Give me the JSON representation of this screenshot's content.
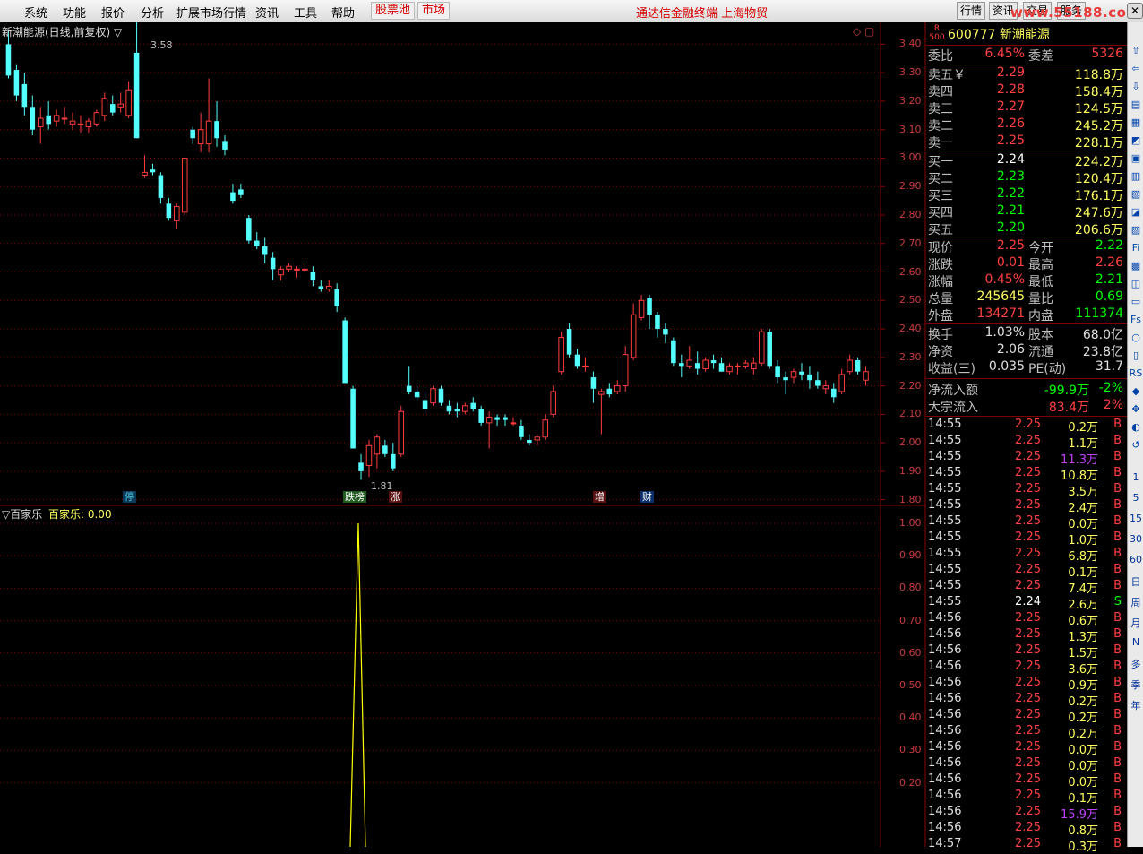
{
  "menu": {
    "items": [
      "系统",
      "功能",
      "报价",
      "分析",
      "扩展市场行情",
      "资讯",
      "工具",
      "帮助"
    ],
    "boxed": [
      "股票池",
      "市场"
    ],
    "center_title": "通达信金融终端  上海物贸",
    "right_buttons": [
      "行情",
      "资讯",
      "交易",
      "服务"
    ],
    "watermark": "www.55188.com"
  },
  "chart": {
    "title": "新潮能源(日线,前复权) ▽",
    "max_label": "3.58",
    "min_label": "1.81",
    "y_ticks": [
      "3.40",
      "3.30",
      "3.20",
      "3.10",
      "3.00",
      "2.90",
      "2.80",
      "2.70",
      "2.60",
      "2.50",
      "2.40",
      "2.30",
      "2.20",
      "2.10",
      "2.00",
      "1.90",
      "1.80"
    ],
    "markers": [
      {
        "text": "停",
        "color": "#4cc3d9",
        "bg": "#0b3a58"
      },
      {
        "text": "跌榜",
        "color": "#ffffff",
        "bg": "#1f5a1f"
      },
      {
        "text": "涨",
        "color": "#ffffff",
        "bg": "#5a1010"
      },
      {
        "text": "增",
        "color": "#ffffff",
        "bg": "#5a1010"
      },
      {
        "text": "财",
        "color": "#ffffff",
        "bg": "#0b2f6a"
      }
    ],
    "colors": {
      "up": "#ff3c3c",
      "down": "#54ffff",
      "grid": "#8b0000",
      "text": "#c83c3c"
    }
  },
  "indicator": {
    "name": "▽百家乐",
    "value_label": "百家乐: 0.00",
    "y_ticks": [
      "1.00",
      "0.90",
      "0.80",
      "0.70",
      "0.60",
      "0.50",
      "0.40",
      "0.30",
      "0.20"
    ],
    "line_color": "#ffff00"
  },
  "quote": {
    "code": "600777",
    "name": "新潮能源",
    "badge_top": "R",
    "badge_bottom": "500",
    "weibi_label": "委比",
    "weibi": "6.45%",
    "weicha_label": "委差",
    "weicha": "5326",
    "asks": [
      {
        "label": "卖五￥",
        "price": "2.29",
        "vol": "118.8万"
      },
      {
        "label": "卖四",
        "price": "2.28",
        "vol": "158.4万"
      },
      {
        "label": "卖三",
        "price": "2.27",
        "vol": "124.5万"
      },
      {
        "label": "卖二",
        "price": "2.26",
        "vol": "245.2万"
      },
      {
        "label": "卖一",
        "price": "2.25",
        "vol": "228.1万"
      }
    ],
    "bids": [
      {
        "label": "买一",
        "price": "2.24",
        "vol": "224.2万",
        "color": "#ffffff"
      },
      {
        "label": "买二",
        "price": "2.23",
        "vol": "120.4万",
        "color": "#00ff00"
      },
      {
        "label": "买三",
        "price": "2.22",
        "vol": "176.1万",
        "color": "#00ff00"
      },
      {
        "label": "买四",
        "price": "2.21",
        "vol": "247.6万",
        "color": "#00ff00"
      },
      {
        "label": "买五",
        "price": "2.20",
        "vol": "206.6万",
        "color": "#00ff00"
      }
    ],
    "stats": [
      {
        "l1": "现价",
        "v1": "2.25",
        "c1": "#ff4040",
        "l2": "今开",
        "v2": "2.22",
        "c2": "#00ff00"
      },
      {
        "l1": "涨跌",
        "v1": "0.01",
        "c1": "#ff4040",
        "l2": "最高",
        "v2": "2.26",
        "c2": "#ff4040"
      },
      {
        "l1": "涨幅",
        "v1": "0.45%",
        "c1": "#ff4040",
        "l2": "最低",
        "v2": "2.21",
        "c2": "#00ff00"
      },
      {
        "l1": "总量",
        "v1": "245645",
        "c1": "#ffff60",
        "l2": "量比",
        "v2": "0.69",
        "c2": "#00ff00"
      },
      {
        "l1": "外盘",
        "v1": "134271",
        "c1": "#ff4040",
        "l2": "内盘",
        "v2": "111374",
        "c2": "#00ff00"
      }
    ],
    "stats2": [
      {
        "l1": "换手",
        "v1": "1.03%",
        "l2": "股本",
        "v2": "68.0亿"
      },
      {
        "l1": "净资",
        "v1": "2.06",
        "l2": "流通",
        "v2": "23.8亿"
      },
      {
        "l1": "收益(三)",
        "v1": "0.035",
        "l2": "PE(动)",
        "v2": "31.7"
      }
    ],
    "flow": [
      {
        "label": "净流入额",
        "v1": "-99.9万",
        "c1": "#00ff00",
        "v2": "-2%",
        "c2": "#00ff00"
      },
      {
        "label": "大宗流入",
        "v1": "83.4万",
        "c1": "#ff4040",
        "v2": "2%",
        "c2": "#ff4040"
      }
    ]
  },
  "ticks": [
    {
      "t": "14:55",
      "p": "2.25",
      "v": "0.2万",
      "s": "B",
      "pc": "#ff4040",
      "vc": "#ffff60",
      "sc": "#ff4040"
    },
    {
      "t": "14:55",
      "p": "2.25",
      "v": "1.1万",
      "s": "B",
      "pc": "#ff4040",
      "vc": "#ffff60",
      "sc": "#ff4040"
    },
    {
      "t": "14:55",
      "p": "2.25",
      "v": "11.3万",
      "s": "B",
      "pc": "#ff4040",
      "vc": "#c040ff",
      "sc": "#ff4040"
    },
    {
      "t": "14:55",
      "p": "2.25",
      "v": "10.8万",
      "s": "B",
      "pc": "#ff4040",
      "vc": "#ffff60",
      "sc": "#ff4040"
    },
    {
      "t": "14:55",
      "p": "2.25",
      "v": "3.5万",
      "s": "B",
      "pc": "#ff4040",
      "vc": "#ffff60",
      "sc": "#ff4040"
    },
    {
      "t": "14:55",
      "p": "2.25",
      "v": "2.4万",
      "s": "B",
      "pc": "#ff4040",
      "vc": "#ffff60",
      "sc": "#ff4040"
    },
    {
      "t": "14:55",
      "p": "2.25",
      "v": "0.0万",
      "s": "B",
      "pc": "#ff4040",
      "vc": "#ffff60",
      "sc": "#ff4040"
    },
    {
      "t": "14:55",
      "p": "2.25",
      "v": "1.0万",
      "s": "B",
      "pc": "#ff4040",
      "vc": "#ffff60",
      "sc": "#ff4040"
    },
    {
      "t": "14:55",
      "p": "2.25",
      "v": "6.8万",
      "s": "B",
      "pc": "#ff4040",
      "vc": "#ffff60",
      "sc": "#ff4040"
    },
    {
      "t": "14:55",
      "p": "2.25",
      "v": "0.1万",
      "s": "B",
      "pc": "#ff4040",
      "vc": "#ffff60",
      "sc": "#ff4040"
    },
    {
      "t": "14:55",
      "p": "2.25",
      "v": "7.4万",
      "s": "B",
      "pc": "#ff4040",
      "vc": "#ffff60",
      "sc": "#ff4040"
    },
    {
      "t": "14:55",
      "p": "2.24",
      "v": "2.6万",
      "s": "S",
      "pc": "#ffffff",
      "vc": "#ffff60",
      "sc": "#00ff00"
    },
    {
      "t": "14:56",
      "p": "2.25",
      "v": "0.6万",
      "s": "B",
      "pc": "#ff4040",
      "vc": "#ffff60",
      "sc": "#ff4040"
    },
    {
      "t": "14:56",
      "p": "2.25",
      "v": "1.3万",
      "s": "B",
      "pc": "#ff4040",
      "vc": "#ffff60",
      "sc": "#ff4040"
    },
    {
      "t": "14:56",
      "p": "2.25",
      "v": "1.5万",
      "s": "B",
      "pc": "#ff4040",
      "vc": "#ffff60",
      "sc": "#ff4040"
    },
    {
      "t": "14:56",
      "p": "2.25",
      "v": "3.6万",
      "s": "B",
      "pc": "#ff4040",
      "vc": "#ffff60",
      "sc": "#ff4040"
    },
    {
      "t": "14:56",
      "p": "2.25",
      "v": "0.9万",
      "s": "B",
      "pc": "#ff4040",
      "vc": "#ffff60",
      "sc": "#ff4040"
    },
    {
      "t": "14:56",
      "p": "2.25",
      "v": "0.2万",
      "s": "B",
      "pc": "#ff4040",
      "vc": "#ffff60",
      "sc": "#ff4040"
    },
    {
      "t": "14:56",
      "p": "2.25",
      "v": "0.2万",
      "s": "B",
      "pc": "#ff4040",
      "vc": "#ffff60",
      "sc": "#ff4040"
    },
    {
      "t": "14:56",
      "p": "2.25",
      "v": "0.2万",
      "s": "B",
      "pc": "#ff4040",
      "vc": "#ffff60",
      "sc": "#ff4040"
    },
    {
      "t": "14:56",
      "p": "2.25",
      "v": "0.0万",
      "s": "B",
      "pc": "#ff4040",
      "vc": "#ffff60",
      "sc": "#ff4040"
    },
    {
      "t": "14:56",
      "p": "2.25",
      "v": "0.0万",
      "s": "B",
      "pc": "#ff4040",
      "vc": "#ffff60",
      "sc": "#ff4040"
    },
    {
      "t": "14:56",
      "p": "2.25",
      "v": "0.0万",
      "s": "B",
      "pc": "#ff4040",
      "vc": "#ffff60",
      "sc": "#ff4040"
    },
    {
      "t": "14:56",
      "p": "2.25",
      "v": "0.1万",
      "s": "B",
      "pc": "#ff4040",
      "vc": "#ffff60",
      "sc": "#ff4040"
    },
    {
      "t": "14:56",
      "p": "2.25",
      "v": "15.9万",
      "s": "B",
      "pc": "#ff4040",
      "vc": "#c040ff",
      "sc": "#ff4040"
    },
    {
      "t": "14:56",
      "p": "2.25",
      "v": "0.8万",
      "s": "B",
      "pc": "#ff4040",
      "vc": "#ffff60",
      "sc": "#ff4040"
    },
    {
      "t": "14:57",
      "p": "2.25",
      "v": "0.3万",
      "s": "B",
      "pc": "#ff4040",
      "vc": "#ffff60",
      "sc": "#ff4040"
    }
  ],
  "sidebar": [
    "1",
    "5",
    "15",
    "30",
    "60",
    "日",
    "周",
    "月",
    "N",
    "多",
    "季",
    "年"
  ],
  "chart_data": {
    "type": "candlestick",
    "title": "新潮能源(日线,前复权)",
    "ylim": [
      1.78,
      3.48
    ],
    "candles": [
      [
        3.4,
        3.45,
        3.28,
        3.29
      ],
      [
        3.31,
        3.33,
        3.2,
        3.22
      ],
      [
        3.26,
        3.3,
        3.15,
        3.18
      ],
      [
        3.18,
        3.22,
        3.08,
        3.1
      ],
      [
        3.11,
        3.18,
        3.05,
        3.14
      ],
      [
        3.15,
        3.2,
        3.1,
        3.12
      ],
      [
        3.13,
        3.17,
        3.11,
        3.15
      ],
      [
        3.14,
        3.18,
        3.12,
        3.14
      ],
      [
        3.12,
        3.16,
        3.1,
        3.13
      ],
      [
        3.12,
        3.15,
        3.09,
        3.12
      ],
      [
        3.11,
        3.14,
        3.09,
        3.13
      ],
      [
        3.12,
        3.17,
        3.11,
        3.16
      ],
      [
        3.15,
        3.23,
        3.13,
        3.21
      ],
      [
        3.19,
        3.22,
        3.15,
        3.16
      ],
      [
        3.18,
        3.23,
        3.16,
        3.19
      ],
      [
        3.15,
        3.27,
        3.14,
        3.24
      ],
      [
        3.37,
        3.58,
        3.07,
        3.07
      ],
      [
        2.94,
        3.01,
        2.93,
        2.95
      ],
      [
        2.96,
        2.98,
        2.94,
        2.95
      ],
      [
        2.94,
        2.95,
        2.84,
        2.86
      ],
      [
        2.84,
        2.86,
        2.78,
        2.79
      ],
      [
        2.78,
        2.84,
        2.75,
        2.83
      ],
      [
        2.81,
        3.0,
        2.8,
        3.0
      ],
      [
        3.1,
        3.11,
        3.05,
        3.07
      ],
      [
        3.05,
        3.16,
        3.02,
        3.1
      ],
      [
        3.05,
        3.28,
        3.02,
        3.13
      ],
      [
        3.13,
        3.2,
        3.04,
        3.07
      ],
      [
        3.06,
        3.08,
        3.01,
        3.03
      ],
      [
        2.88,
        2.91,
        2.84,
        2.85
      ],
      [
        2.89,
        2.91,
        2.86,
        2.87
      ],
      [
        2.79,
        2.8,
        2.7,
        2.71
      ],
      [
        2.71,
        2.74,
        2.68,
        2.69
      ],
      [
        2.69,
        2.72,
        2.63,
        2.66
      ],
      [
        2.65,
        2.67,
        2.57,
        2.61
      ],
      [
        2.59,
        2.62,
        2.57,
        2.61
      ],
      [
        2.61,
        2.63,
        2.6,
        2.62
      ],
      [
        2.61,
        2.62,
        2.58,
        2.61
      ],
      [
        2.61,
        2.63,
        2.6,
        2.61
      ],
      [
        2.6,
        2.62,
        2.55,
        2.57
      ],
      [
        2.55,
        2.57,
        2.53,
        2.54
      ],
      [
        2.54,
        2.57,
        2.53,
        2.55
      ],
      [
        2.54,
        2.56,
        2.46,
        2.48
      ],
      [
        2.43,
        2.44,
        2.21,
        2.21
      ],
      [
        2.19,
        2.2,
        1.98,
        1.98
      ],
      [
        1.93,
        1.96,
        1.87,
        1.9
      ],
      [
        1.92,
        2.01,
        1.88,
        1.99
      ],
      [
        1.96,
        2.03,
        1.91,
        2.02
      ],
      [
        1.99,
        2.01,
        1.95,
        1.96
      ],
      [
        1.96,
        2.0,
        1.9,
        1.91
      ],
      [
        1.96,
        2.13,
        1.95,
        2.11
      ],
      [
        2.2,
        2.27,
        2.17,
        2.18
      ],
      [
        2.18,
        2.2,
        2.15,
        2.16
      ],
      [
        2.15,
        2.18,
        2.1,
        2.12
      ],
      [
        2.14,
        2.2,
        2.13,
        2.19
      ],
      [
        2.19,
        2.2,
        2.13,
        2.14
      ],
      [
        2.13,
        2.15,
        2.1,
        2.11
      ],
      [
        2.12,
        2.14,
        2.09,
        2.11
      ],
      [
        2.11,
        2.14,
        2.1,
        2.13
      ],
      [
        2.14,
        2.16,
        2.11,
        2.12
      ],
      [
        2.12,
        2.13,
        2.06,
        2.07
      ],
      [
        2.07,
        2.11,
        1.98,
        2.09
      ],
      [
        2.09,
        2.1,
        2.06,
        2.08
      ],
      [
        2.09,
        2.1,
        2.06,
        2.08
      ],
      [
        2.07,
        2.09,
        2.06,
        2.07
      ],
      [
        2.06,
        2.08,
        2.01,
        2.02
      ],
      [
        2.01,
        2.03,
        1.99,
        2.0
      ],
      [
        2.01,
        2.03,
        1.99,
        2.02
      ],
      [
        2.02,
        2.1,
        2.01,
        2.08
      ],
      [
        2.1,
        2.2,
        2.09,
        2.18
      ],
      [
        2.25,
        2.39,
        2.24,
        2.37
      ],
      [
        2.4,
        2.42,
        2.3,
        2.31
      ],
      [
        2.31,
        2.33,
        2.26,
        2.27
      ],
      [
        2.27,
        2.3,
        2.25,
        2.27
      ],
      [
        2.23,
        2.25,
        2.14,
        2.19
      ],
      [
        2.17,
        2.19,
        2.03,
        2.18
      ],
      [
        2.19,
        2.21,
        2.16,
        2.17
      ],
      [
        2.18,
        2.22,
        2.17,
        2.2
      ],
      [
        2.2,
        2.34,
        2.18,
        2.31
      ],
      [
        2.3,
        2.49,
        2.29,
        2.45
      ],
      [
        2.44,
        2.52,
        2.43,
        2.5
      ],
      [
        2.51,
        2.52,
        2.4,
        2.45
      ],
      [
        2.45,
        2.46,
        2.37,
        2.4
      ],
      [
        2.4,
        2.42,
        2.35,
        2.38
      ],
      [
        2.36,
        2.37,
        2.27,
        2.28
      ],
      [
        2.28,
        2.31,
        2.23,
        2.27
      ],
      [
        2.27,
        2.34,
        2.26,
        2.29
      ],
      [
        2.28,
        2.32,
        2.24,
        2.26
      ],
      [
        2.26,
        2.3,
        2.25,
        2.29
      ],
      [
        2.29,
        2.31,
        2.26,
        2.28
      ],
      [
        2.28,
        2.3,
        2.25,
        2.25
      ],
      [
        2.25,
        2.28,
        2.24,
        2.27
      ],
      [
        2.27,
        2.28,
        2.24,
        2.27
      ],
      [
        2.27,
        2.29,
        2.26,
        2.28
      ],
      [
        2.26,
        2.3,
        2.24,
        2.28
      ],
      [
        2.28,
        2.4,
        2.27,
        2.39
      ],
      [
        2.39,
        2.4,
        2.26,
        2.27
      ],
      [
        2.27,
        2.29,
        2.21,
        2.23
      ],
      [
        2.23,
        2.25,
        2.17,
        2.22
      ],
      [
        2.23,
        2.26,
        2.21,
        2.25
      ],
      [
        2.25,
        2.28,
        2.22,
        2.24
      ],
      [
        2.24,
        2.27,
        2.19,
        2.22
      ],
      [
        2.22,
        2.25,
        2.19,
        2.2
      ],
      [
        2.19,
        2.22,
        2.17,
        2.2
      ],
      [
        2.19,
        2.21,
        2.14,
        2.16
      ],
      [
        2.18,
        2.26,
        2.17,
        2.24
      ],
      [
        2.25,
        2.31,
        2.24,
        2.29
      ],
      [
        2.29,
        2.3,
        2.24,
        2.25
      ],
      [
        2.22,
        2.27,
        2.2,
        2.25
      ]
    ],
    "indicator_values_note": "百家乐 indicator: 0 except spike to 1.00 near lowest candle"
  }
}
